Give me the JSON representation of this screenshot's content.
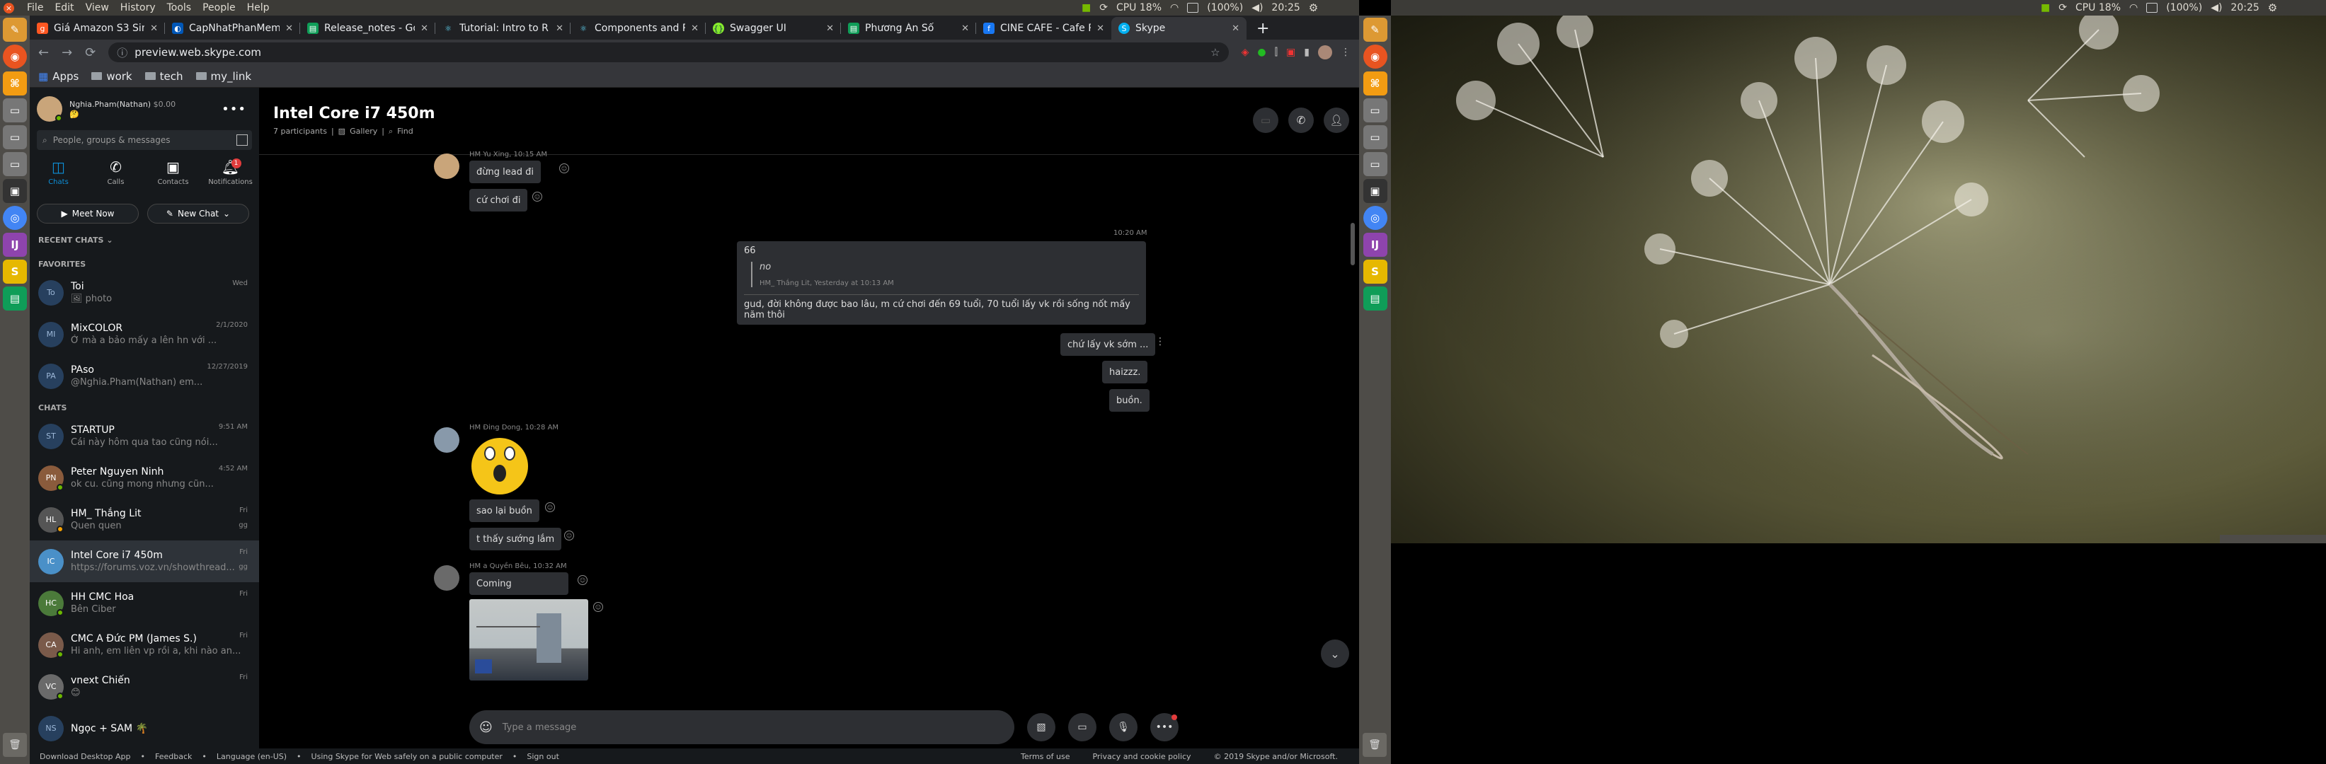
{
  "topbar": {
    "menus": [
      "File",
      "Edit",
      "View",
      "History",
      "Tools",
      "People",
      "Help"
    ],
    "cpu": "CPU 18%",
    "battery": "(100%)",
    "time": "20:25"
  },
  "browser": {
    "tabs": [
      {
        "title": "Giá Amazon S3 Sim",
        "color": "#e0e0e0"
      },
      {
        "title": "CapNhatPhanMem",
        "color": "#e0e0e0"
      },
      {
        "title": "Release_notes - Go",
        "color": "#0f9d58"
      },
      {
        "title": "Tutorial: Intro to R",
        "color": "#61dafb"
      },
      {
        "title": "Components and P",
        "color": "#61dafb"
      },
      {
        "title": "Swagger UI",
        "color": "#85ea2d"
      },
      {
        "title": "Phương Án Số",
        "color": "#0f9d58"
      },
      {
        "title": "CINE CAFE - Cafe Ph",
        "color": "#1877f2"
      },
      {
        "title": "Skype",
        "color": "#00aff0"
      }
    ],
    "url": "preview.web.skype.com",
    "bookmarks": [
      "Apps",
      "work",
      "tech",
      "my_link"
    ]
  },
  "profile": {
    "name": "Nghia.Pham(Nathan)",
    "balance": "$0.00",
    "mood": "🤔"
  },
  "search": {
    "placeholder": "People, groups & messages"
  },
  "nav": [
    {
      "label": "Chats",
      "icon": "chat-icon"
    },
    {
      "label": "Calls",
      "icon": "phone-icon"
    },
    {
      "label": "Contacts",
      "icon": "contacts-icon"
    },
    {
      "label": "Notifications",
      "icon": "bell-icon",
      "badge": "1"
    }
  ],
  "actions": {
    "meet_now": "Meet Now",
    "new_chat": "New Chat"
  },
  "recent_label": "RECENT CHATS",
  "favorites_label": "FAVORITES",
  "favorites": [
    {
      "initials": "To",
      "name": "Toi",
      "preview": "🖼 photo",
      "date": "Wed"
    },
    {
      "initials": "MI",
      "name": "MixCOLOR",
      "preview": "Ở mà a bảo mấy a lên hn với ...",
      "date": "2/1/2020"
    },
    {
      "initials": "PA",
      "name": "PAso",
      "preview": "@Nghia.Pham(Nathan) em...",
      "date": "12/27/2019"
    }
  ],
  "chats_label": "CHATS",
  "chats": [
    {
      "initials": "ST",
      "name": "STARTUP",
      "preview": "Cái này hôm qua tao cũng nói...",
      "date": "9:51 AM",
      "mark": ""
    },
    {
      "initials": "PN",
      "name": "Peter Nguyen Ninh",
      "preview": "ok cu. cũng mong nhưng cũn...",
      "date": "4:52 AM",
      "mark": ""
    },
    {
      "initials": "HL",
      "name": "HM_ Thắng Lit",
      "preview": "Quen quen",
      "date": "Fri",
      "mark": "gg"
    },
    {
      "initials": "IC",
      "name": "Intel Core i7 450m",
      "preview": "https://forums.voz.vn/showthread...",
      "date": "Fri",
      "mark": "gg",
      "selected": true
    },
    {
      "initials": "HC",
      "name": "HH CMC Hoa",
      "preview": "Bên Ciber",
      "date": "Fri",
      "mark": ""
    },
    {
      "initials": "CA",
      "name": "CMC A Đức PM (James S.)",
      "preview": "Hi anh, em liên vp rồi a, khi nào an...",
      "date": "Fri",
      "mark": ""
    },
    {
      "initials": "VC",
      "name": "vnext Chiến",
      "preview": "😊",
      "date": "Fri",
      "mark": ""
    },
    {
      "initials": "NS",
      "name": "Ngọc + SAM 🌴",
      "preview": "",
      "date": "",
      "mark": ""
    }
  ],
  "conversation": {
    "title": "Intel Core i7 450m",
    "participants": "7 participants",
    "gallery": "Gallery",
    "find": "Find",
    "messages": {
      "m1_meta": "HM Yu Xing, 10:15 AM",
      "m1_a": "đừng lead đi",
      "m1_b": "cứ chơi đi",
      "m2_time": "10:20 AM",
      "m2_text": "66",
      "m2_quote": "no",
      "m2_quote_meta": "HM_ Thắng Lit, Yesterday at 10:13 AM",
      "m2_reply": "gud, đời không được bao lâu, m cứ chơi đến 69 tuổi, 70 tuổi lấy vk rồi sống nốt mấy năm thôi",
      "m3": "chứ lấy vk sớm ...",
      "m4": "haizzz.",
      "m5": "buồn.",
      "m6_meta": "HM Đing Dong, 10:28 AM",
      "m6_a": "sao lại buồn",
      "m6_b": "t thấy sướng lắm",
      "m7_meta": "HM a Quyền Bêu, 10:32 AM",
      "m7_a": "Coming"
    },
    "composer_placeholder": "Type a message"
  },
  "footer": {
    "left": [
      "Download Desktop App",
      "Feedback",
      "Language (en-US)",
      "Using Skype for Web safely on a public computer",
      "Sign out"
    ],
    "right": [
      "Terms of use",
      "Privacy and cookie policy",
      "© 2019 Skype and/or Microsoft."
    ]
  },
  "colors": {
    "accent": "#0d8fd8",
    "ubuntu_orange": "#e95420",
    "panel": "#3c3b37"
  }
}
